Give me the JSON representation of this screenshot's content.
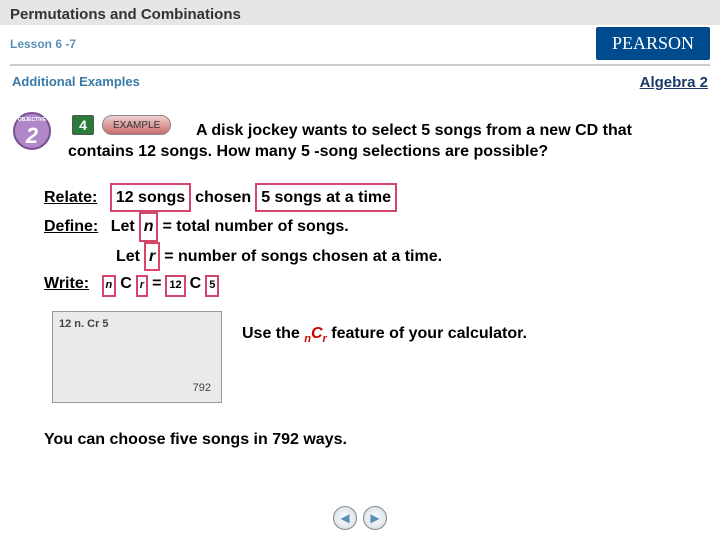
{
  "header": {
    "title": "Permutations and Combinations",
    "lesson": "Lesson 6 -7",
    "publisher": "PEARSON"
  },
  "info": {
    "additional": "Additional Examples",
    "algebra": "Algebra 2"
  },
  "example": {
    "number": "4",
    "label": "EXAMPLE",
    "problem": "A disk jockey wants to select 5 songs from a new CD that contains 12 songs. How many 5 -song selections are possible?"
  },
  "relate": {
    "label": "Relate:",
    "part1": "12 songs",
    "mid": "chosen",
    "part2": "5 songs at a time"
  },
  "define": {
    "label": "Define:",
    "let1a": "Let",
    "var_n": "n",
    "let1b": "= total number of songs.",
    "let2a": "Let",
    "var_r": "r",
    "let2b": "= number of songs chosen at a time."
  },
  "write": {
    "label": "Write:",
    "sub_n": "n",
    "C": "C",
    "sub_r": "r",
    "eq": "=",
    "sub_12": "12",
    "sub_5": "5"
  },
  "calc": {
    "display_top": "12 n. Cr 5",
    "display_result": "792",
    "text1": "Use the ",
    "ncr_n": "n",
    "ncr_C": "C",
    "ncr_r": "r",
    "text2": " feature of your calculator."
  },
  "conclusion": "You can choose five songs in 792 ways."
}
